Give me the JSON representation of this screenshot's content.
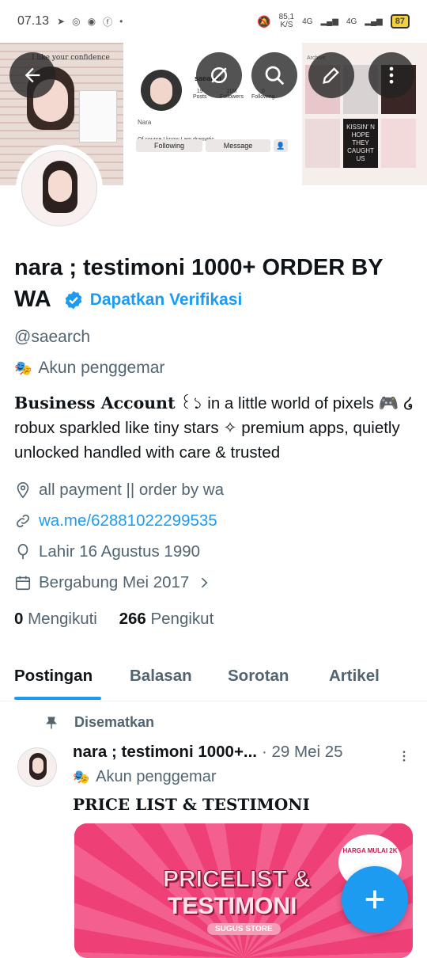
{
  "status_bar": {
    "time": "07.13",
    "network_speed": "85,1",
    "network_unit": "K/S",
    "signal1": "4G",
    "signal2": "4G",
    "battery": "87"
  },
  "banner": {
    "left_caption": "I like your confidence",
    "mid_handle": "saearch",
    "mid_stats": [
      {
        "value": "19",
        "label": "Posts"
      },
      {
        "value": "11M",
        "label": "Followers"
      },
      {
        "value": "0",
        "label": "Following"
      }
    ],
    "mid_name": "Nara",
    "mid_bio": "Of course I know I am dramatic",
    "mid_following_btn": "Following",
    "mid_message_btn": "Message",
    "right_label": "Archive",
    "right_tile_text": "KISSIN' N HOPE THEY CAUGHT US"
  },
  "profile": {
    "display_name": "nara ; testimoni 1000+ ORDER BY WA",
    "verify_label": "Dapatkan Verifikasi",
    "handle": "@saearch",
    "fan_label": "Akun penggemar",
    "bio_bold": "Business Account",
    "bio_text": " ꒰১ in a little world of pixels 🎮 ໒ robux sparkled like tiny stars ✧ premium apps, quietly unlocked handled with care & trusted",
    "location": "all payment || order by wa",
    "link": "wa.me/62881022299535",
    "birthday": "Lahir 16 Agustus 1990",
    "joined": "Bergabung Mei 2017",
    "following_count": "0",
    "following_label": "Mengikuti",
    "followers_count": "266",
    "followers_label": "Pengikut"
  },
  "tabs": [
    {
      "label": "Postingan",
      "active": true
    },
    {
      "label": "Balasan",
      "active": false
    },
    {
      "label": "Sorotan",
      "active": false
    },
    {
      "label": "Artikel",
      "active": false
    }
  ],
  "pinned_post": {
    "pinned_label": "Disematkan",
    "author": "nara ; testimoni 1000+...",
    "date": "· 29 Mei 25",
    "fan_label": "Akun penggemar",
    "text": "PRICE LIST & TESTIMONI",
    "media_title1": "PRICELIST &",
    "media_title2": "TESTIMONI",
    "media_subtitle": "SUGUS STORE",
    "media_badge": "HARGA MULAI 2K"
  },
  "colors": {
    "accent": "#1d9bf0",
    "text_primary": "#0f1419",
    "text_secondary": "#536471"
  }
}
